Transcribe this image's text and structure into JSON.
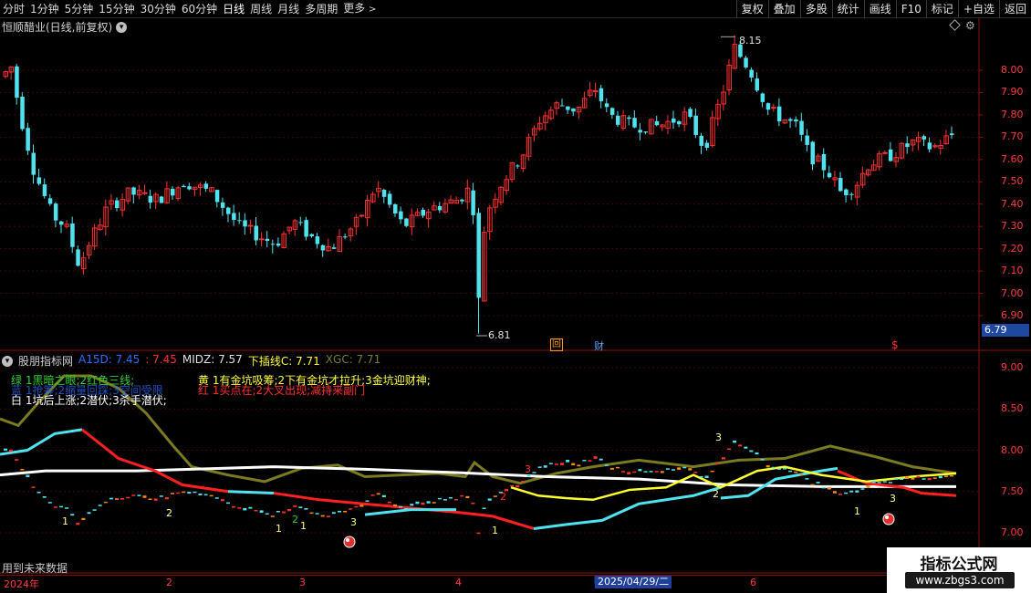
{
  "toolbar": {
    "periods": [
      "分时",
      "1分钟",
      "5分钟",
      "15分钟",
      "30分钟",
      "60分钟",
      "日线",
      "周线",
      "月线",
      "多周期",
      "更多"
    ],
    "more_arrow": ">",
    "right_tools": [
      "复权",
      "叠加",
      "多股",
      "统计",
      "画线",
      "F10",
      "标记",
      "+自选",
      "返回"
    ]
  },
  "main": {
    "title": "恒顺醋业(日线,前复权)",
    "high_label": "8.15",
    "low_label": "6.81",
    "price_axis": [
      "8.00",
      "7.90",
      "7.80",
      "7.70",
      "7.60",
      "7.50",
      "7.40",
      "7.30",
      "7.20",
      "7.10",
      "7.00",
      "6.90"
    ],
    "current_price": "6.79",
    "markers": [
      "回",
      "财",
      "$"
    ],
    "colors": {
      "up": "#ff3030",
      "down": "#4fe3f0",
      "bg": "#000000"
    }
  },
  "indicator": {
    "name": "股朋指标网",
    "values": [
      {
        "label": "A15D: 7.45",
        "color": "#2d6dff"
      },
      {
        "label": ": 7.45",
        "color": "#ff3030"
      },
      {
        "label": "MIDZ: 7.57",
        "color": "#e0e0e0"
      },
      {
        "label": "下插线C: 7.71",
        "color": "#ffff40"
      },
      {
        "label": "XGC: 7.71",
        "color": "#7a7a30"
      }
    ],
    "descs": [
      {
        "text": "绿 1黑暗之眼;2红色三线;",
        "color": "#30d030"
      },
      {
        "text": "蓝 1抢筹;2缩量回踩;3空间受限",
        "color": "#2d6dff"
      },
      {
        "text": "白 1坑后上涨;2潜伏;3杀手潜伏;",
        "color": "#ffffff"
      },
      {
        "text": "黄 1有金坑吸筹;2下有金坑才拉升;3金坑迎财神;",
        "color": "#ffff40"
      },
      {
        "text": "红 1买点在;2大叉出现;减持来副门",
        "color": "#ff3030"
      }
    ],
    "axis": [
      "9.00",
      "8.50",
      "8.00",
      "7.50",
      "7.00"
    ],
    "signals": [
      "1",
      "2",
      "1",
      "2",
      "1",
      "3",
      "1",
      "2",
      "3",
      "1",
      "3",
      "2",
      "3"
    ]
  },
  "footer": {
    "note": "用到未来数据",
    "dates": [
      "2024年",
      "2",
      "3",
      "4",
      "6"
    ],
    "cursor_date": "2025/04/29/二"
  },
  "watermark": {
    "title": "指标公式网",
    "url": "www.zbgs3.com"
  }
}
